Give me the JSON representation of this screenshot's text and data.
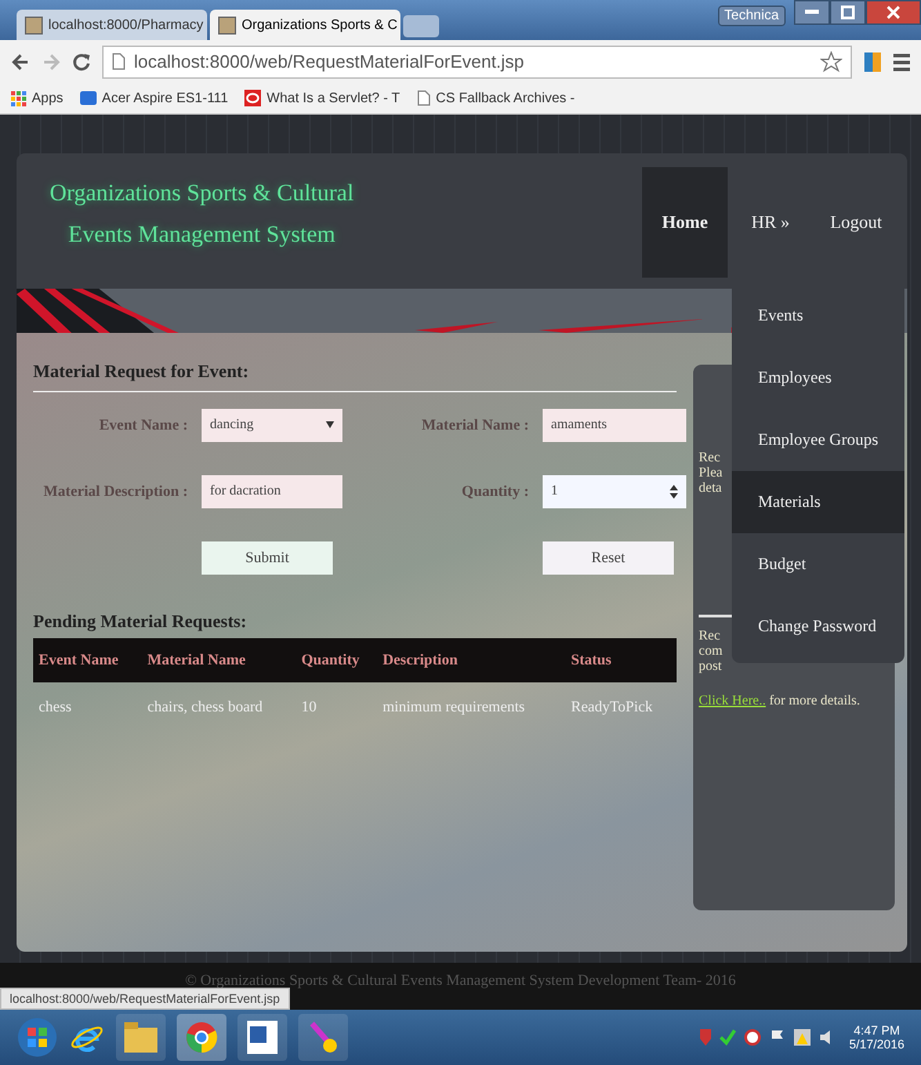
{
  "browser": {
    "tabs": [
      {
        "title": "localhost:8000/Pharmacy",
        "selected": false
      },
      {
        "title": "Organizations Sports & C",
        "selected": true
      }
    ],
    "profile_button": "Technica",
    "address": "localhost:8000/web/RequestMaterialForEvent.jsp",
    "bookmarks": [
      {
        "label": "Apps",
        "kind": "apps"
      },
      {
        "label": "Acer Aspire ES1-111",
        "kind": "sd"
      },
      {
        "label": "What Is a Servlet? - T",
        "kind": "red"
      },
      {
        "label": "CS Fallback Archives -",
        "kind": "page"
      }
    ]
  },
  "site": {
    "title_lines": [
      "Organizations Sports & Cultural",
      "Events Management System"
    ],
    "nav": [
      {
        "label": "Home",
        "selected": true
      },
      {
        "label": "HR »",
        "selected": false
      },
      {
        "label": "Logout",
        "selected": false
      }
    ],
    "dropdown": [
      {
        "label": "Events",
        "selected": false
      },
      {
        "label": "Employees",
        "selected": false
      },
      {
        "label": "Employee Groups",
        "selected": false
      },
      {
        "label": "Materials",
        "selected": true
      },
      {
        "label": "Budget",
        "selected": false
      },
      {
        "label": "Change Password",
        "selected": false
      }
    ],
    "form": {
      "heading": "Material Request for Event:",
      "fields": [
        {
          "label": "Event Name :",
          "value": "dancing",
          "kind": "select"
        },
        {
          "label": "Material Name :",
          "value": "amaments",
          "kind": "text"
        },
        {
          "label": "Material Description :",
          "value": "for dacration",
          "kind": "text"
        },
        {
          "label": "Quantity :",
          "value": "1",
          "kind": "number"
        }
      ],
      "buttons": [
        "Submit",
        "Reset"
      ]
    },
    "pending": {
      "heading": "Pending Material Requests:",
      "columns": [
        "Event Name",
        "Material Name",
        "Quantity",
        "Description",
        "Status"
      ],
      "rows": [
        [
          "chess",
          "chairs, chess board",
          "10",
          "minimum requirements",
          "ReadyToPick"
        ]
      ]
    },
    "side_panel": {
      "block_1": [
        "Rec",
        "Plea",
        "deta"
      ],
      "block_2": [
        "Rec",
        "com",
        "post"
      ],
      "link": "Click Here..",
      "link_suffix": " for more details."
    },
    "footer": "© Organizations Sports & Cultural Events Management System Development Team- 2016",
    "status_url": "localhost:8000/web/RequestMaterialForEvent.jsp",
    "taskbar": {
      "time": "4:47 PM",
      "date": "5/17/2016"
    }
  }
}
